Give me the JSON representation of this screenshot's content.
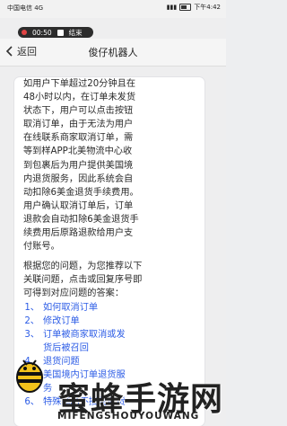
{
  "status_bar": {
    "left_text": "中国电信 4G",
    "time": "下午4:42"
  },
  "recording": {
    "elapsed": "00:50",
    "stop_label": "结束"
  },
  "header": {
    "back_label": "返回",
    "title": "俊仔机器人"
  },
  "message": {
    "lines": [
      "如用户下单超过20分钟且在",
      "48小时以内，在订单未发货",
      "状态下，用户可以点击按钮",
      "取消订单，由于无法为用户",
      "在线联系商家取消订单，需",
      "等到样APP北美物流中心收",
      "到包裹后为用户提供美国境",
      "内退货服务，因此系统会自",
      "动扣除6美金退货手续费用。",
      "用户确认取消订单后，订单",
      "退款会自动扣除6美金退货手",
      "续费用后原路退款给用户支",
      "付账号。"
    ],
    "prompt_lines": [
      "根据您的问题，为您推荐以下",
      "关联问题，点击或回复序号即",
      "可得到对应问题的答案："
    ],
    "questions": [
      {
        "num": "1、",
        "text": "如何取消订单"
      },
      {
        "num": "2、",
        "text": "修改订单"
      },
      {
        "num": "3、",
        "text": "订单被商家取消或发"
      },
      {
        "num": "",
        "text": "货后被召回"
      },
      {
        "num": "4、",
        "text": "退货问题"
      },
      {
        "num": "5、",
        "text": "美国境内订单退货服"
      },
      {
        "num": "",
        "text": "务"
      },
      {
        "num": "6、",
        "text": "特殊商品不接受退货"
      }
    ]
  },
  "watermark": {
    "main": "蜜蜂手游网",
    "sub": "MIFENGSHOUYOUWANG"
  }
}
